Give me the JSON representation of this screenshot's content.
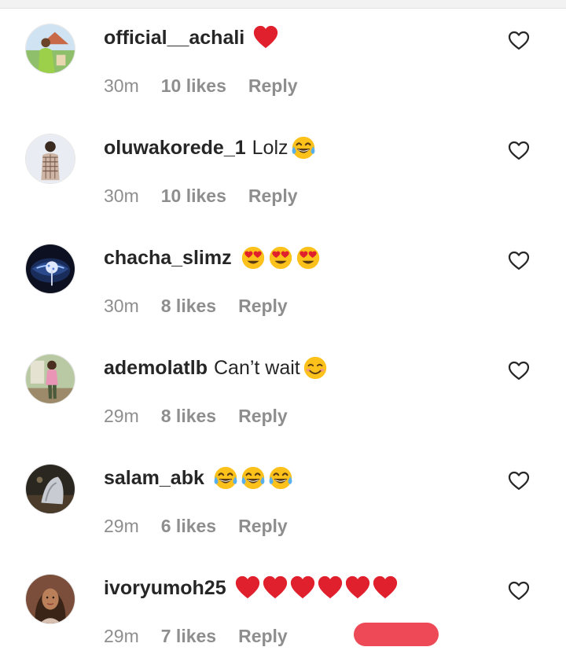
{
  "comments": [
    {
      "username": "official__achali",
      "text": "",
      "emojis": [
        "heart"
      ],
      "time": "30m",
      "likes": "10 likes",
      "reply": "Reply",
      "avatar": "avatar-green-outfit"
    },
    {
      "username": "oluwakorede_1",
      "text": "Lolz",
      "emojis": [
        "tears-of-joy"
      ],
      "time": "30m",
      "likes": "10 likes",
      "reply": "Reply",
      "avatar": "avatar-boy-standing"
    },
    {
      "username": "chacha_slimz",
      "text": "",
      "emojis": [
        "heart-eyes",
        "heart-eyes",
        "heart-eyes"
      ],
      "time": "30m",
      "likes": "8 likes",
      "reply": "Reply",
      "avatar": "avatar-lips-lollipop"
    },
    {
      "username": "ademolatlb",
      "text": "Can’t wait",
      "emojis": [
        "smiling-face"
      ],
      "time": "29m",
      "likes": "8 likes",
      "reply": "Reply",
      "avatar": "avatar-man-pink-shirt"
    },
    {
      "username": "salam_abk",
      "text": "",
      "emojis": [
        "tears-of-joy",
        "tears-of-joy",
        "tears-of-joy"
      ],
      "time": "29m",
      "likes": "6 likes",
      "reply": "Reply",
      "avatar": "avatar-dark-photo"
    },
    {
      "username": "ivoryumoh25",
      "text": "",
      "emojis": [
        "heart",
        "heart",
        "heart",
        "heart",
        "heart",
        "heart"
      ],
      "time": "29m",
      "likes": "7 likes",
      "reply": "Reply",
      "avatar": "avatar-woman"
    }
  ],
  "colors": {
    "username": "#262626",
    "meta": "#8e8e8e",
    "heart_red": "#e0202c",
    "like_outline": "#262626",
    "floating_pill": "#ed4956"
  }
}
